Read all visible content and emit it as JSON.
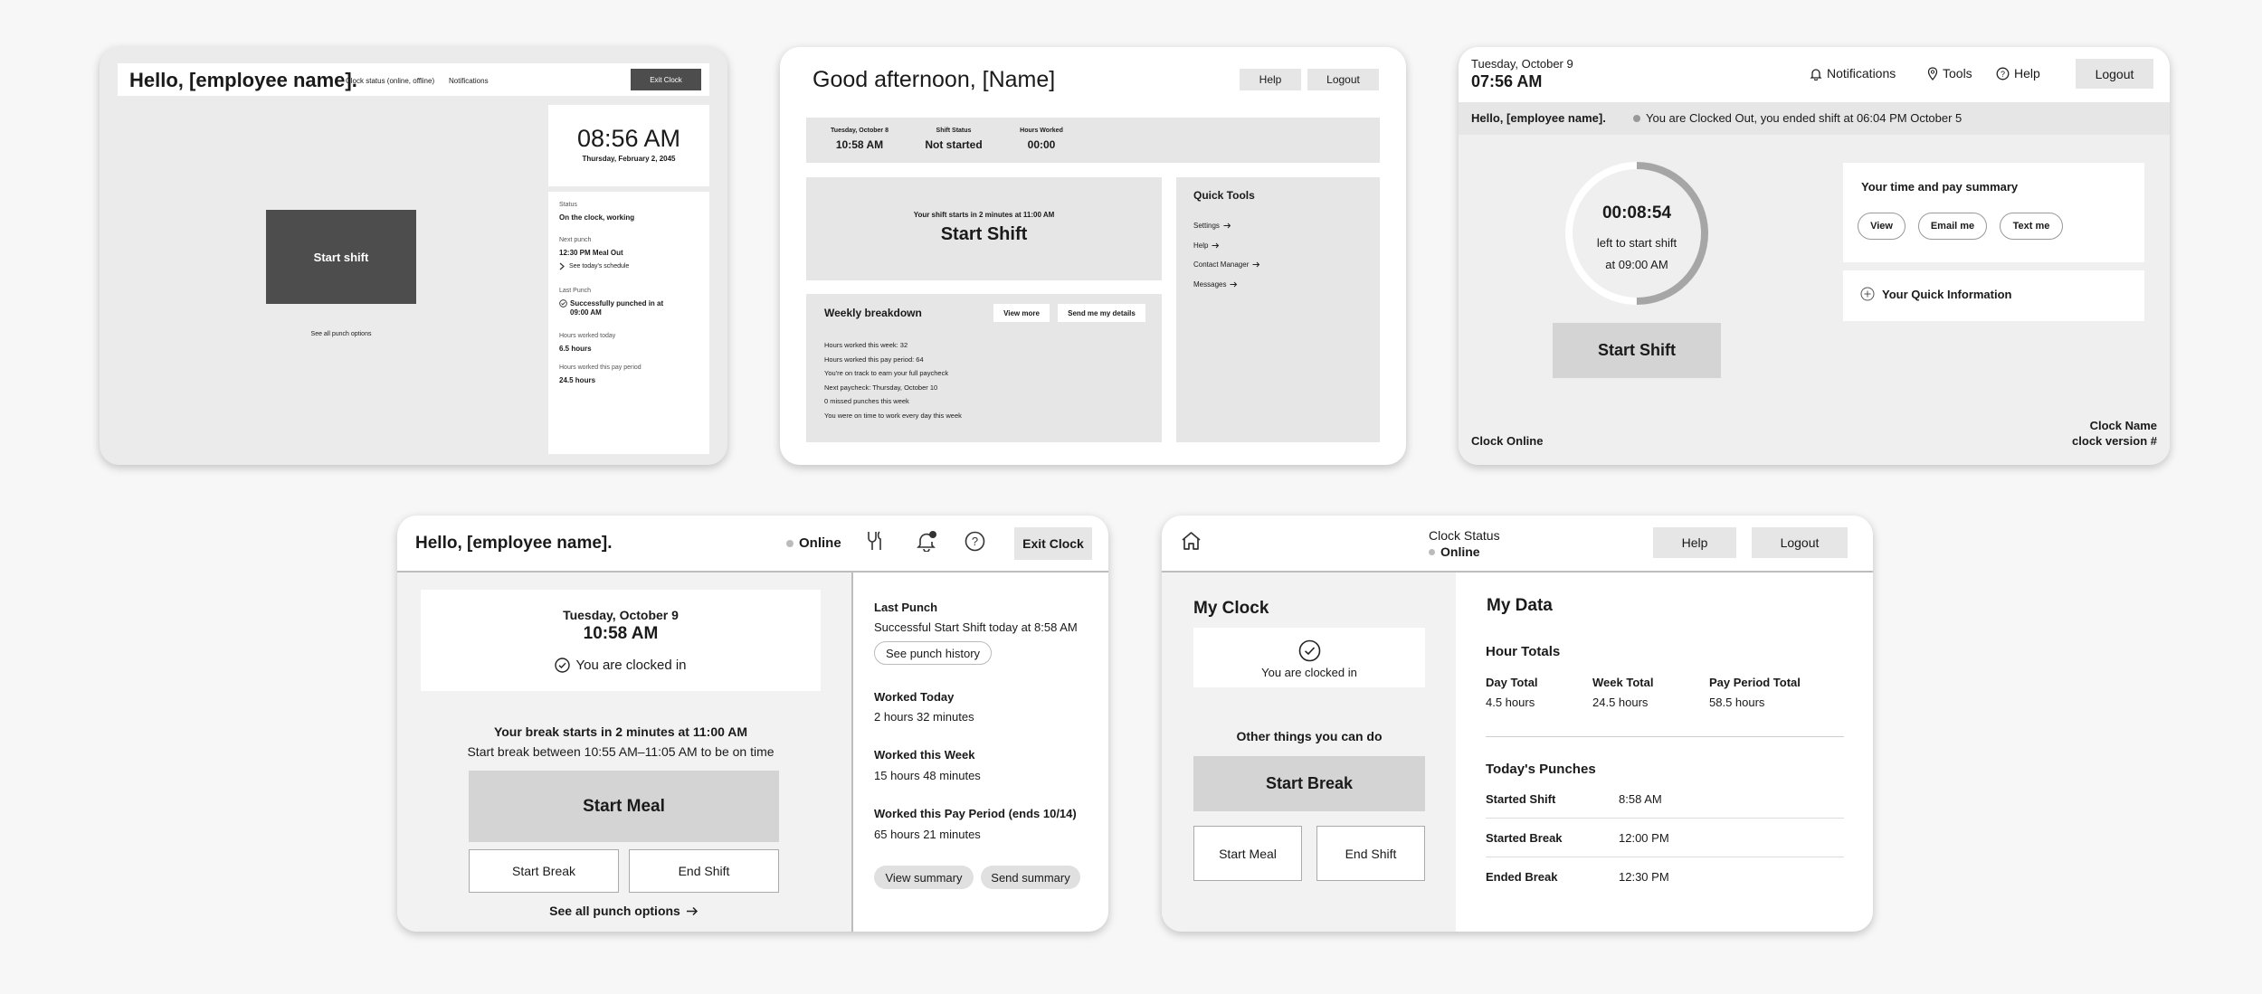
{
  "card1": {
    "greeting": "Hello, [employee name].",
    "clock_status": "Clock status (online, offline)",
    "notifications": "Notifications",
    "exit_clock": "Exit Clock",
    "time": "08:56 AM",
    "date": "Thursday, February 2, 2045",
    "start_shift": "Start shift",
    "see_all": "See all punch options",
    "status_label": "Status",
    "status_value": "On the clock, working",
    "next_punch_label": "Next punch",
    "next_punch_value": "12:30 PM  Meal Out",
    "see_schedule": "See today's schedule",
    "last_punch_label": "Last Punch",
    "last_punch_value": "Successfully punched in at 09:00 AM",
    "hours_today_label": "Hours worked today",
    "hours_today_value": "6.5 hours",
    "hours_period_label": "Hours worked this pay period",
    "hours_period_value": "24.5 hours"
  },
  "card2": {
    "greeting": "Good afternoon, [Name]",
    "help": "Help",
    "logout": "Logout",
    "stat_date_label": "Tuesday, October 8",
    "stat_date_value": "10:58 AM",
    "stat_shift_label": "Shift Status",
    "stat_shift_value": "Not started",
    "stat_hours_label": "Hours Worked",
    "stat_hours_value": "00:00",
    "shift_note": "Your shift starts in 2 minutes at 11:00 AM",
    "start_shift": "Start Shift",
    "quick_tools": "Quick Tools",
    "tools": [
      "Settings",
      "Help",
      "Contact Manager",
      "Messages"
    ],
    "weekly_title": "Weekly breakdown",
    "view_more": "View more",
    "send_details": "Send me my details",
    "weekly_lines": [
      "Hours worked this week: 32",
      "Hours worked this pay period: 64",
      "You're on track to earn your full paycheck",
      "Next paycheck: Thursday, October 10",
      "0 missed punches this week",
      "You were on time to work every day this week"
    ]
  },
  "card3": {
    "date": "Tuesday, October 9",
    "time": "07:56 AM",
    "notifications": "Notifications",
    "tools": "Tools",
    "help": "Help",
    "logout": "Logout",
    "greeting": "Hello, [employee name].",
    "status_msg": "You are Clocked Out, you ended shift at 06:04 PM October 5",
    "countdown": "00:08:54",
    "countdown_sub1": "left to start shift",
    "countdown_sub2": "at 09:00 AM",
    "countdown_progress": 0.5,
    "start_shift": "Start Shift",
    "summary_title": "Your time and pay summary",
    "view": "View",
    "email_me": "Email me",
    "text_me": "Text me",
    "quick_info": "Your Quick Information",
    "clock_online": "Clock Online",
    "clock_name": "Clock Name",
    "clock_version": "clock version #"
  },
  "card4": {
    "greeting": "Hello, [employee name].",
    "online": "Online",
    "exit_clock": "Exit Clock",
    "date": "Tuesday, October 9",
    "time": "10:58 AM",
    "clocked_in": "You are clocked in",
    "break_note": "Your break starts in 2 minutes at 11:00 AM",
    "break_window": "Start break between 10:55 AM–11:05 AM to be on time",
    "start_meal": "Start Meal",
    "start_break": "Start Break",
    "end_shift": "End Shift",
    "see_all": "See all punch options",
    "last_punch_label": "Last Punch",
    "last_punch_value": "Successful Start Shift today at 8:58 AM",
    "see_history": "See punch history",
    "worked_today_label": "Worked Today",
    "worked_today_value": "2 hours 32 minutes",
    "worked_week_label": "Worked this Week",
    "worked_week_value": "15 hours 48 minutes",
    "worked_period_label": "Worked this Pay Period (ends 10/14)",
    "worked_period_value": "65 hours 21 minutes",
    "view_summary": "View summary",
    "send_summary": "Send summary"
  },
  "card5": {
    "clock_status": "Clock Status",
    "online": "Online",
    "help": "Help",
    "logout": "Logout",
    "my_clock": "My Clock",
    "clocked_in": "You are clocked in",
    "other_things": "Other things you can do",
    "start_break": "Start Break",
    "start_meal": "Start Meal",
    "end_shift": "End Shift",
    "my_data": "My Data",
    "hour_totals": "Hour Totals",
    "day_total_label": "Day Total",
    "day_total_value": "4.5 hours",
    "week_total_label": "Week Total",
    "week_total_value": "24.5 hours",
    "period_total_label": "Pay Period Total",
    "period_total_value": "58.5 hours",
    "todays_punches": "Today's Punches",
    "punches": [
      {
        "label": "Started Shift",
        "time": "8:58 AM"
      },
      {
        "label": "Started Break",
        "time": "12:00 PM"
      },
      {
        "label": "Ended Break",
        "time": "12:30 PM"
      }
    ]
  }
}
